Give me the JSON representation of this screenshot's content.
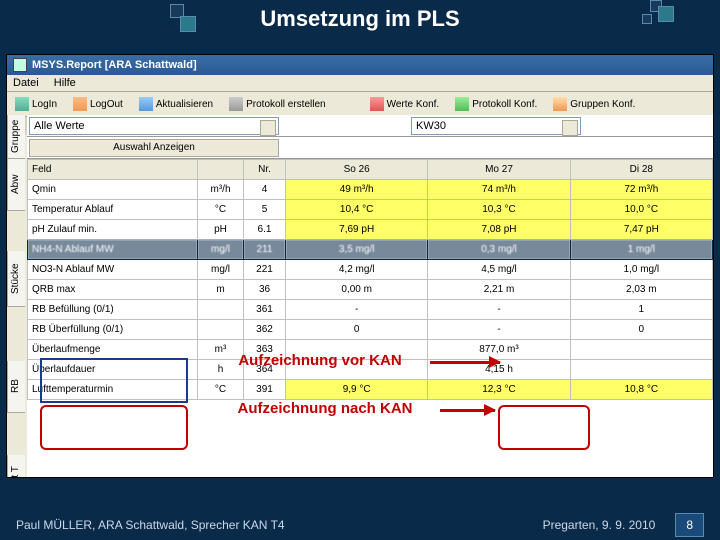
{
  "slide": {
    "title": "Umsetzung im PLS",
    "footer_left": "Paul MÜLLER, ARA Schattwald, Sprecher KAN T4",
    "footer_right": "Pregarten, 9. 9. 2010",
    "slide_number": "8",
    "callout_before": "Aufzeichnung vor KAN",
    "callout_after": "Aufzeichnung nach KAN"
  },
  "window": {
    "title": "MSYS.Report [ARA Schattwald]",
    "menu": {
      "file": "Datei",
      "help": "Hilfe"
    }
  },
  "toolbar": {
    "login": "LogIn",
    "logout": "LogOut",
    "refresh": "Aktualisieren",
    "protocol": "Protokoll erstellen",
    "werte_konf": "Werte Konf.",
    "protokoll_konf": "Protokoll Konf.",
    "gruppen_konf": "Gruppen Konf."
  },
  "filter": {
    "values_combo": "Alle Werte",
    "kw_combo": "KW30",
    "auswahl_btn": "Auswahl Anzeigen"
  },
  "vtabs": {
    "gruppe": "Gruppe",
    "abw": "Abw",
    "stucke": "Stücke",
    "rb": "RB",
    "luft": "uft T"
  },
  "columns": {
    "feld": "Feld",
    "unit": "",
    "nr": "Nr.",
    "days": [
      "So 26",
      "Mo 27",
      "Di 28"
    ]
  },
  "rows": [
    {
      "label": "Qmin",
      "unit": "m³/h",
      "nr": "4",
      "vals": [
        "49 m³/h",
        "74 m³/h",
        "72 m³/h"
      ],
      "hl": true
    },
    {
      "label": "Temperatur Ablauf",
      "unit": "°C",
      "nr": "5",
      "vals": [
        "10,4 °C",
        "10,3 °C",
        "10,0 °C"
      ],
      "hl": true
    },
    {
      "label": "pH Zulauf min.",
      "unit": "pH",
      "nr": "6.1",
      "vals": [
        "7,69 pH",
        "7,08 pH",
        "7,47 pH"
      ],
      "hl": true
    },
    {
      "label": "NH4-N Ablauf MW",
      "unit": "mg/l",
      "nr": "211",
      "vals": [
        "3,5 mg/l",
        "0,3 mg/l",
        "1 mg/l"
      ],
      "blur": true
    },
    {
      "label": "NO3-N Ablauf MW",
      "unit": "mg/l",
      "nr": "221",
      "vals": [
        "4,2 mg/l",
        "4,5 mg/l",
        "1,0 mg/l"
      ]
    },
    {
      "label": "QRB max",
      "unit": "m",
      "nr": "36",
      "vals": [
        "0,00 m",
        "2,21 m",
        "2,03 m"
      ]
    },
    {
      "label": "RB Befüllung (0/1)",
      "unit": "",
      "nr": "361",
      "vals": [
        "-",
        "-",
        "1"
      ]
    },
    {
      "label": "RB Überfüllung (0/1)",
      "unit": "",
      "nr": "362",
      "vals": [
        "0",
        "-",
        "0"
      ]
    },
    {
      "label": "Überlaufmenge",
      "unit": "m³",
      "nr": "363",
      "vals": [
        "",
        "877,0 m³",
        ""
      ]
    },
    {
      "label": "Überlaufdauer",
      "unit": "h",
      "nr": "364",
      "vals": [
        "",
        "4,15 h",
        ""
      ]
    },
    {
      "label": "Lufttemperaturmin",
      "unit": "°C",
      "nr": "391",
      "vals": [
        "9,9 °C",
        "12,3 °C",
        "10,8 °C"
      ],
      "hl": true
    }
  ]
}
